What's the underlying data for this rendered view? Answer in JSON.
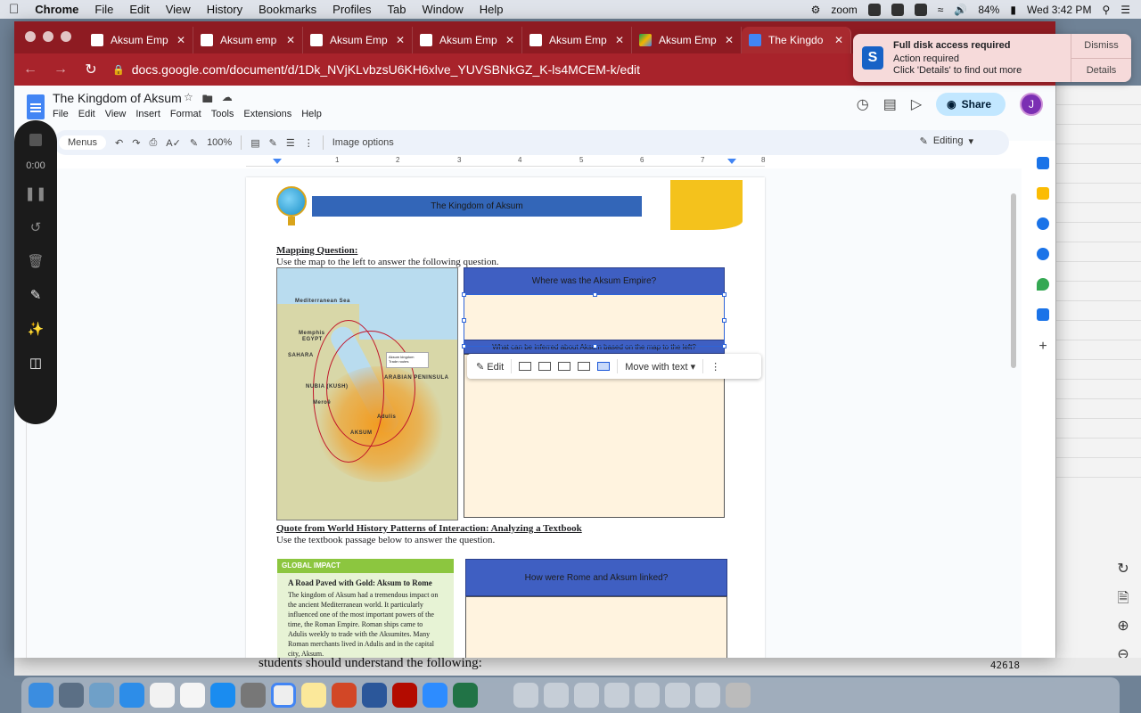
{
  "menubar": {
    "app": "Chrome",
    "items": [
      "File",
      "Edit",
      "View",
      "History",
      "Bookmarks",
      "Profiles",
      "Tab",
      "Window",
      "Help"
    ],
    "status": {
      "zoom": "zoom",
      "battery": "84%",
      "clock": "Wed 3:42 PM"
    }
  },
  "browser": {
    "tabs": [
      {
        "label": "Aksum Emp",
        "icon": "classroom-icon"
      },
      {
        "label": "Aksum emp",
        "icon": "classroom-icon"
      },
      {
        "label": "Aksum Emp",
        "icon": "classroom-icon"
      },
      {
        "label": "Aksum Emp",
        "icon": "classroom-icon"
      },
      {
        "label": "Aksum Emp",
        "icon": "classroom-icon"
      },
      {
        "label": "Aksum Emp",
        "icon": "drive-icon"
      },
      {
        "label": "The Kingdo",
        "icon": "docs-icon"
      }
    ],
    "url": "docs.google.com/document/d/1Dk_NVjKLvbzsU6KH6xlve_YUVSBNkGZ_K-ls4MCEM-k/edit"
  },
  "notification": {
    "title": "Full disk access required",
    "line1": "Action required",
    "line2": "Click 'Details' to find out more",
    "dismiss": "Dismiss",
    "details": "Details"
  },
  "docs": {
    "title": "The Kingdom of Aksum",
    "menu": [
      "File",
      "Edit",
      "View",
      "Insert",
      "Format",
      "Tools",
      "Extensions",
      "Help"
    ],
    "share": "Share",
    "avatar": "J",
    "toolbar": {
      "menus": "Menus",
      "zoom": "100%",
      "image_options": "Image options",
      "mode": "Editing"
    },
    "ruler_ticks": [
      "1",
      "2",
      "3",
      "4",
      "5",
      "6",
      "7",
      "8"
    ]
  },
  "page": {
    "banner": "The Kingdom of Aksum",
    "mapping_heading": "Mapping Question:",
    "mapping_text": "Use the map to the left to answer the following question.",
    "q1": "Where was the Aksum Empire?",
    "q2_partial": "What can be inferred about Aksum based on the map to the left?",
    "map_labels": {
      "sea": "Mediterranean Sea",
      "egypt": "EGYPT",
      "sahara": "SAHARA",
      "nubia": "NUBIA (KUSH)",
      "aksum": "AKSUM",
      "arabian": "ARABIAN PENINSULA",
      "memphis": "Memphis",
      "meroe": "Meroë",
      "adulis": "Adulis",
      "legend1": "Aksum kingdom",
      "legend2": "Trade routes"
    },
    "quote_heading": "Quote from World History Patterns of Interaction: Analyzing a Textbook",
    "quote_text": "Use the textbook passage below to answer the question.",
    "q3": "How were Rome and Aksum linked?",
    "global_impact": {
      "tag": "GLOBAL IMPACT",
      "title": "A Road Paved with Gold: Aksum to Rome",
      "body": "The kingdom of Aksum had a tremendous impact on the ancient Mediterranean world. It particularly influenced one of the most important powers of the time, the Roman Empire. Roman ships came to Adulis weekly to trade with the Aksumites. Many Roman merchants lived in Adulis and in the capital city, Aksum."
    }
  },
  "image_toolbar": {
    "edit": "Edit",
    "position": "Move with text"
  },
  "recorder": {
    "time": "0:00"
  },
  "background": {
    "text_line": "students should understand the following:",
    "number": "42618"
  },
  "colors": {
    "chrome_frame": "#8e1b22",
    "docs_blue": "#4285f4",
    "banner_blue": "#3366b8",
    "answer_fill": "#fff3df",
    "global_green": "#8cc63f"
  }
}
